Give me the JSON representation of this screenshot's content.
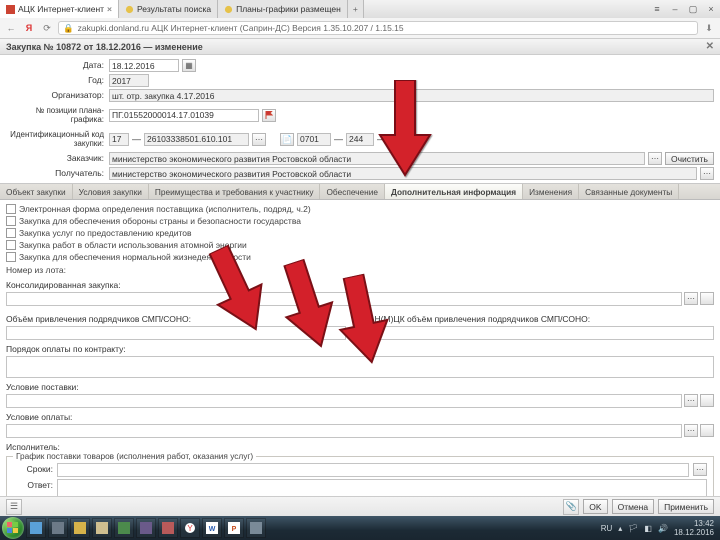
{
  "browser": {
    "tabs": [
      {
        "title": "АЦК Интернет-клиент",
        "active": true
      },
      {
        "title": "Результаты поиска",
        "active": false
      },
      {
        "title": "Планы-графики размещен",
        "active": false
      }
    ],
    "page_url": "zakupki.donland.ru  АЦК Интернет-клиент (Саприн-ДС)  Версия 1.35.10.207 / 1.15.15",
    "app_title": "АЦК Интернет-клиент (Саприн-ДС)  Версия 1.35.10.207 / 1.15.15"
  },
  "doc": {
    "title": "Закупка № 10872 от 18.12.2016 — изменение",
    "fields": {
      "date_label": "Дата:",
      "date_value": "18.12.2016",
      "year_label": "Год:",
      "year_value": "2017",
      "org_label": "Организатор:",
      "org_value": "шт. отр. закупка 4.17.2016",
      "pos_label": "№ позиции плана-графика:",
      "pos_value": "ПГ.01552000014.17.01039",
      "ikz_label": "Идентификационный код закупки:",
      "ikz_part1": "17",
      "ikz_part2": "26103338501.610.101",
      "ikz_part3": "0701",
      "ikz_part4": "244",
      "zakazchik_label": "Заказчик:",
      "zakazchik_value": "министерство экономического развития Ростовской области",
      "poluchatel_label": "Получатель:",
      "poluchatel_value": "министерство экономического развития Ростовской области",
      "clear_btn": "Очистить"
    },
    "tabs": [
      "Объект закупки",
      "Условия закупки",
      "Преимущества и требования к участнику",
      "Обеспечение",
      "Дополнительная информация",
      "Изменения",
      "Связанные документы"
    ],
    "active_tab_index": 4,
    "checks": [
      "Электронная форма определения поставщика (исполнитель, подряд, ч.2)",
      "Закупка для обеспечения обороны страны и безопасности государства",
      "Закупка услуг по предоставлению кредитов",
      "Закупка работ в области использования атомной энергии",
      "Закупка для обеспечения нормальной жизнедеятельности"
    ],
    "nomer_lota_label": "Номер из лота:",
    "sections": {
      "consolid": "Консолидированная закупка:",
      "volume_left_label": "Объём привлечения подрядчиков СМП/СОНО:",
      "volume_right_label": "% от Н(М)ЦК объём привлечения подрядчиков СМП/СОНО:",
      "poryadok": "Порядок оплаты по контракту:",
      "uslovie_post": "Условие поставки:",
      "uslovie_opl": "Условие оплаты:",
      "ispolnitel": "Исполнитель:"
    },
    "group": {
      "legend": "График поставки товаров (исполнения работ, оказания услуг)",
      "strok_label": "Сроки:",
      "otvet_label": "Ответ:"
    },
    "bottom": {
      "ok": "OK",
      "cancel": "Отмена",
      "apply": "Применить"
    }
  },
  "taskbar": {
    "lang": "RU",
    "time": "13:42",
    "date": "18.12.2016"
  }
}
